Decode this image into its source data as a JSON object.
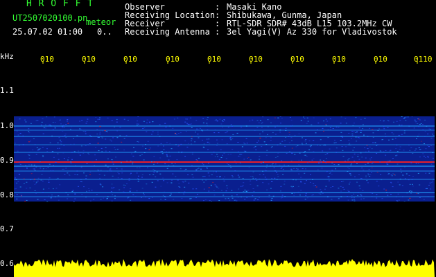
{
  "header": {
    "logo": "H R O F F T",
    "file_name": "UT2507020100.pn",
    "file_tag": "meteor",
    "date_time": "25.07.02 01:00",
    "count": "0..",
    "rows": [
      {
        "label": "Observer",
        "value": "Masaki Kano"
      },
      {
        "label": "Receiving Location",
        "value": "Shibukawa, Gunma, Japan"
      },
      {
        "label": "Receiver",
        "value": "RTL-SDR SDR# 43dB L15 103.2MHz CW"
      },
      {
        "label": "Receiving Antenna",
        "value": "3el Yagi(V) Az 330 for Vladivostok"
      }
    ]
  },
  "axis": {
    "unit": "kHz",
    "y_ticks": [
      "1.1",
      "1.0",
      "0.9",
      "0.8",
      "0.7",
      "0.6"
    ],
    "time_ticks": [
      "010",
      "010",
      "010",
      "010",
      "010",
      "010",
      "010",
      "010",
      "010",
      "0110"
    ]
  },
  "colors": {
    "background": "#000000",
    "signal_low": "#0a1f8f",
    "signal_mid": "#22a0ff",
    "signal_high": "#ff2020",
    "echo_bar": "#ffff00",
    "header_green": "#33ff33",
    "tick_yellow": "#ffff00"
  }
}
